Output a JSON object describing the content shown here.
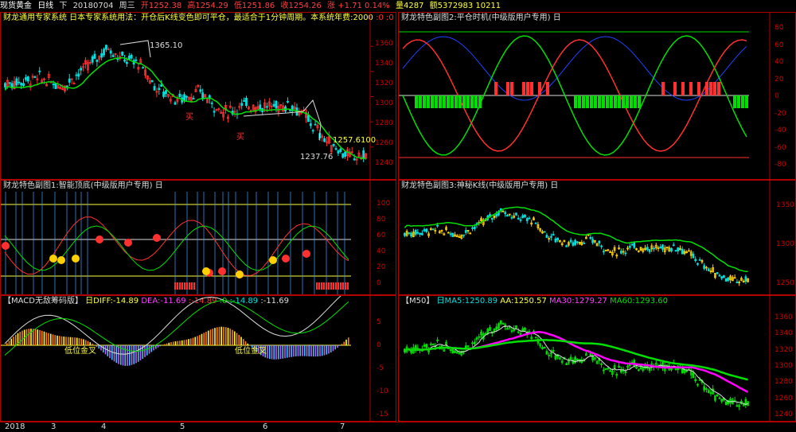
{
  "header": {
    "symbol": "现货黄金",
    "period": "日线",
    "mode": "下",
    "date": "20180704",
    "weekday": "周三",
    "open": "开1252.38",
    "high": "高1254.29",
    "low": "低1251.86",
    "close": "收1254.26",
    "change": "涨 +1.71 0.14%",
    "volume": "量4287",
    "amount": "额5372983 10211"
  },
  "main": {
    "title": "财龙通用专家系统 日本专家系统用法：开仓后K线变色即可平仓，最适合于1分钟周期。本系统年费:2000",
    "title_extra": ":0 :0",
    "high_label": "1365.10",
    "low_label": "1237.76",
    "current_label": "1257.6100",
    "buy_label": "买",
    "axis": [
      "1360",
      "1340",
      "1320",
      "1300",
      "1280",
      "1260",
      "1240"
    ]
  },
  "sub1": {
    "title": "财龙特色副图1:智能顶底(中级版用户专用) 日",
    "axis": [
      "100",
      "80",
      "60",
      "40",
      "20",
      "0"
    ]
  },
  "macd": {
    "title": "【MACD无敌筹码版】",
    "diff": "日DIFF:-14.89",
    "dea": "DEA:-11.69",
    "v1": ":-14.89",
    "v2": ":0",
    "v3": ":-14.89",
    "v4": ":-11.69",
    "golden_cross": "低位金叉",
    "axis": [
      "5",
      "0",
      "-5",
      "-10",
      "-15"
    ]
  },
  "sub2": {
    "title": "财龙特色副图2:平仓时机(中级版用户专用) 日",
    "axis": [
      "80",
      "60",
      "40",
      "20",
      "0",
      "-20",
      "-40",
      "-60",
      "-80"
    ]
  },
  "sub3": {
    "title": "财龙特色副图3:神秘K线(中级版用户专用) 日",
    "axis": [
      "1350",
      "1300",
      "1250"
    ]
  },
  "m50": {
    "title": "【M50】",
    "ma5": "日MA5:1250.89",
    "aa": "AA:1250.57",
    "ma30": "MA30:1279.27",
    "ma60": "MA60:1293.60",
    "axis": [
      "1360",
      "1340",
      "1320",
      "1300",
      "1280",
      "1260",
      "1240"
    ]
  },
  "xaxis": {
    "labels": [
      "2018",
      "3",
      "4",
      "5",
      "6",
      "7"
    ]
  },
  "colors": {
    "up": "#ff3030",
    "down": "#00e0e0",
    "green": "#00e000",
    "magenta": "#ff00ff",
    "yellow": "#ffff00",
    "blue": "#2040ff",
    "axis": "#d00000"
  }
}
